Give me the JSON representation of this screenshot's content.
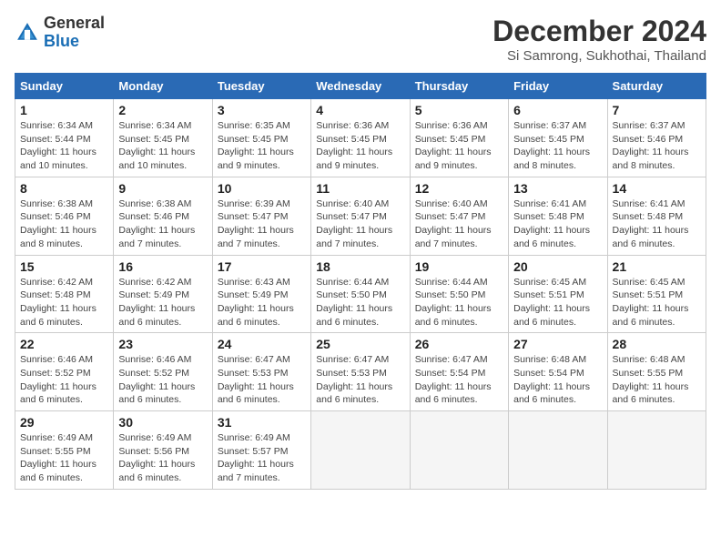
{
  "header": {
    "logo_general": "General",
    "logo_blue": "Blue",
    "title": "December 2024",
    "location": "Si Samrong, Sukhothai, Thailand"
  },
  "days_of_week": [
    "Sunday",
    "Monday",
    "Tuesday",
    "Wednesday",
    "Thursday",
    "Friday",
    "Saturday"
  ],
  "weeks": [
    [
      {
        "day": "1",
        "detail": "Sunrise: 6:34 AM\nSunset: 5:44 PM\nDaylight: 11 hours\nand 10 minutes."
      },
      {
        "day": "2",
        "detail": "Sunrise: 6:34 AM\nSunset: 5:45 PM\nDaylight: 11 hours\nand 10 minutes."
      },
      {
        "day": "3",
        "detail": "Sunrise: 6:35 AM\nSunset: 5:45 PM\nDaylight: 11 hours\nand 9 minutes."
      },
      {
        "day": "4",
        "detail": "Sunrise: 6:36 AM\nSunset: 5:45 PM\nDaylight: 11 hours\nand 9 minutes."
      },
      {
        "day": "5",
        "detail": "Sunrise: 6:36 AM\nSunset: 5:45 PM\nDaylight: 11 hours\nand 9 minutes."
      },
      {
        "day": "6",
        "detail": "Sunrise: 6:37 AM\nSunset: 5:45 PM\nDaylight: 11 hours\nand 8 minutes."
      },
      {
        "day": "7",
        "detail": "Sunrise: 6:37 AM\nSunset: 5:46 PM\nDaylight: 11 hours\nand 8 minutes."
      }
    ],
    [
      {
        "day": "8",
        "detail": "Sunrise: 6:38 AM\nSunset: 5:46 PM\nDaylight: 11 hours\nand 8 minutes."
      },
      {
        "day": "9",
        "detail": "Sunrise: 6:38 AM\nSunset: 5:46 PM\nDaylight: 11 hours\nand 7 minutes."
      },
      {
        "day": "10",
        "detail": "Sunrise: 6:39 AM\nSunset: 5:47 PM\nDaylight: 11 hours\nand 7 minutes."
      },
      {
        "day": "11",
        "detail": "Sunrise: 6:40 AM\nSunset: 5:47 PM\nDaylight: 11 hours\nand 7 minutes."
      },
      {
        "day": "12",
        "detail": "Sunrise: 6:40 AM\nSunset: 5:47 PM\nDaylight: 11 hours\nand 7 minutes."
      },
      {
        "day": "13",
        "detail": "Sunrise: 6:41 AM\nSunset: 5:48 PM\nDaylight: 11 hours\nand 6 minutes."
      },
      {
        "day": "14",
        "detail": "Sunrise: 6:41 AM\nSunset: 5:48 PM\nDaylight: 11 hours\nand 6 minutes."
      }
    ],
    [
      {
        "day": "15",
        "detail": "Sunrise: 6:42 AM\nSunset: 5:48 PM\nDaylight: 11 hours\nand 6 minutes."
      },
      {
        "day": "16",
        "detail": "Sunrise: 6:42 AM\nSunset: 5:49 PM\nDaylight: 11 hours\nand 6 minutes."
      },
      {
        "day": "17",
        "detail": "Sunrise: 6:43 AM\nSunset: 5:49 PM\nDaylight: 11 hours\nand 6 minutes."
      },
      {
        "day": "18",
        "detail": "Sunrise: 6:44 AM\nSunset: 5:50 PM\nDaylight: 11 hours\nand 6 minutes."
      },
      {
        "day": "19",
        "detail": "Sunrise: 6:44 AM\nSunset: 5:50 PM\nDaylight: 11 hours\nand 6 minutes."
      },
      {
        "day": "20",
        "detail": "Sunrise: 6:45 AM\nSunset: 5:51 PM\nDaylight: 11 hours\nand 6 minutes."
      },
      {
        "day": "21",
        "detail": "Sunrise: 6:45 AM\nSunset: 5:51 PM\nDaylight: 11 hours\nand 6 minutes."
      }
    ],
    [
      {
        "day": "22",
        "detail": "Sunrise: 6:46 AM\nSunset: 5:52 PM\nDaylight: 11 hours\nand 6 minutes."
      },
      {
        "day": "23",
        "detail": "Sunrise: 6:46 AM\nSunset: 5:52 PM\nDaylight: 11 hours\nand 6 minutes."
      },
      {
        "day": "24",
        "detail": "Sunrise: 6:47 AM\nSunset: 5:53 PM\nDaylight: 11 hours\nand 6 minutes."
      },
      {
        "day": "25",
        "detail": "Sunrise: 6:47 AM\nSunset: 5:53 PM\nDaylight: 11 hours\nand 6 minutes."
      },
      {
        "day": "26",
        "detail": "Sunrise: 6:47 AM\nSunset: 5:54 PM\nDaylight: 11 hours\nand 6 minutes."
      },
      {
        "day": "27",
        "detail": "Sunrise: 6:48 AM\nSunset: 5:54 PM\nDaylight: 11 hours\nand 6 minutes."
      },
      {
        "day": "28",
        "detail": "Sunrise: 6:48 AM\nSunset: 5:55 PM\nDaylight: 11 hours\nand 6 minutes."
      }
    ],
    [
      {
        "day": "29",
        "detail": "Sunrise: 6:49 AM\nSunset: 5:55 PM\nDaylight: 11 hours\nand 6 minutes."
      },
      {
        "day": "30",
        "detail": "Sunrise: 6:49 AM\nSunset: 5:56 PM\nDaylight: 11 hours\nand 6 minutes."
      },
      {
        "day": "31",
        "detail": "Sunrise: 6:49 AM\nSunset: 5:57 PM\nDaylight: 11 hours\nand 7 minutes."
      },
      {
        "day": "",
        "detail": ""
      },
      {
        "day": "",
        "detail": ""
      },
      {
        "day": "",
        "detail": ""
      },
      {
        "day": "",
        "detail": ""
      }
    ]
  ]
}
